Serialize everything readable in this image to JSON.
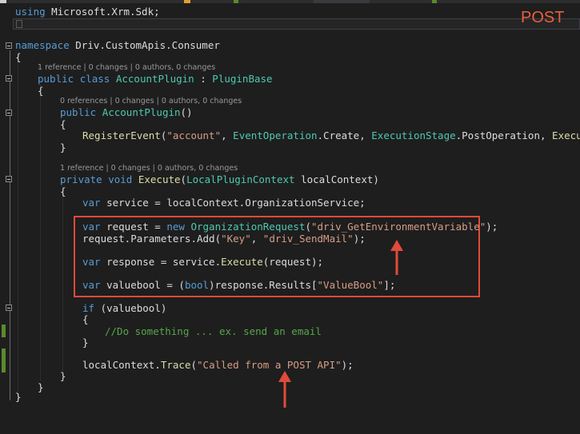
{
  "annotation": {
    "label": "POST",
    "color": "#e8603c",
    "box_color": "#e04a3a",
    "arrow_color": "#e04a3a"
  },
  "colors": {
    "background": "#1e1e1e",
    "keyword": "#569cd6",
    "type": "#4ec9b0",
    "string": "#d69d85",
    "comment": "#57a64a",
    "method": "#dcdcaa",
    "plain": "#dcdcdc",
    "codelens": "#999999"
  },
  "code": {
    "using_kw": "using",
    "using_ns": "Microsoft.Xrm.Sdk;",
    "ns_kw": "namespace",
    "ns_name": "Driv.CustomApis.Consumer",
    "brace_open": "{",
    "brace_close": "}",
    "lens_class": "1 reference | 0 changes | 0 authors, 0 changes",
    "class_kw1": "public",
    "class_kw2": "class",
    "class_name": "AccountPlugin",
    "class_colon": ":",
    "class_base": "PluginBase",
    "lens_ctor": "0 references | 0 changes | 0 authors, 0 changes",
    "ctor_kw": "public",
    "ctor_name": "AccountPlugin",
    "ctor_parens": "()",
    "reg_method": "RegisterEvent",
    "reg_open": "(",
    "reg_str": "\"account\"",
    "reg_sep1": ", ",
    "reg_t1": "EventOperation",
    "reg_m1": ".Create, ",
    "reg_t2": "ExecutionStage",
    "reg_m2": ".PostOperation, ",
    "reg_m3": "Execute",
    "reg_close": ");",
    "lens_exec": "1 reference | 0 changes | 0 authors, 0 changes",
    "exec_kw1": "private",
    "exec_kw2": "void",
    "exec_name": "Execute",
    "exec_open": "(",
    "exec_type": "LocalPluginContext",
    "exec_param": " localContext)",
    "var_kw": "var",
    "svc_name": " service = localContext.OrganizationService;",
    "req_left": " request = ",
    "new_kw": "new",
    "req_type": " OrganizationRequest",
    "req_open": "(",
    "req_str": "\"driv_GetEnvironmentVariable\"",
    "req_close": ");",
    "params_left": "request.Parameters.Add(",
    "params_key": "\"Key\"",
    "params_sep": ", ",
    "params_val": "\"driv_SendMail\"",
    "params_close": ");",
    "resp_left": " response = service.",
    "resp_method": "Execute",
    "resp_right": "(request);",
    "vb_left": " valuebool = (",
    "vb_type": "bool",
    "vb_mid": ")response.Results[",
    "vb_str": "\"ValueBool\"",
    "vb_close": "];",
    "if_kw": "if",
    "if_cond": " (valuebool)",
    "comment": "//Do something ... ex. send an email",
    "trace_left": "localContext.",
    "trace_method": "Trace",
    "trace_open": "(",
    "trace_str": "\"Called from a POST API\"",
    "trace_close": ");"
  }
}
